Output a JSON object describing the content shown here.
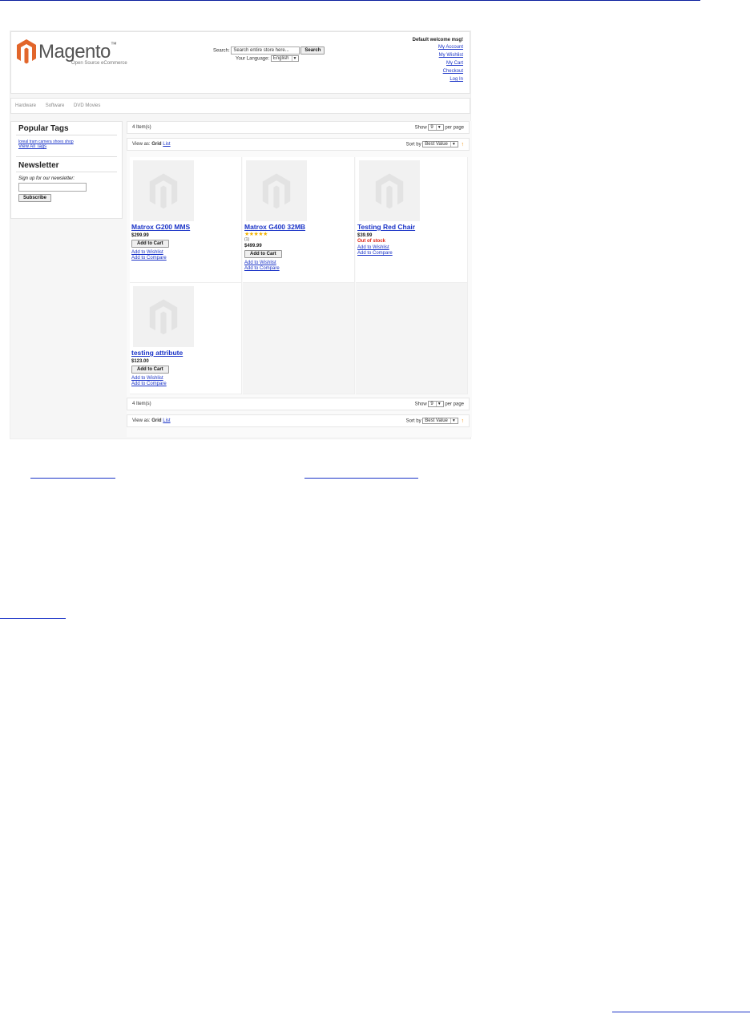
{
  "logo": {
    "word": "Magento",
    "tm": "™",
    "subtitle": "Open Source eCommerce"
  },
  "header": {
    "search_label": "Search:",
    "search_placeholder": "Search entire store here...",
    "search_button": "Search",
    "language_label": "Your Language:",
    "language_value": "English",
    "welcome": "Default welcome msg!",
    "links": [
      "My Account",
      "My Wishlist",
      "My Cart",
      "Checkout",
      "Log In"
    ]
  },
  "nav": {
    "items": [
      "Hardware",
      "Software",
      "DVD Movies"
    ]
  },
  "sidebar": {
    "tags_title": "Popular Tags",
    "tags_text": "loreal  tram  camera  shoes  shop",
    "view_all": "View All Tags",
    "newsletter_title": "Newsletter",
    "newsletter_label": "Sign up for our newsletter:",
    "subscribe": "Subscribe"
  },
  "toolbar": {
    "items_count": "4 Item(s)",
    "show_label": "Show",
    "show_value": "9",
    "per_page": "per page",
    "view_as": "View as:",
    "grid": "Grid",
    "list": "List",
    "sort_by": "Sort by",
    "sort_value": "Best Value",
    "rss_icon": "arrow-up-icon"
  },
  "products": [
    {
      "name": "Matrox G200 MMS",
      "price": "$299.99",
      "add_to_cart": "Add to Cart",
      "wishlist": "Add to Wishlist",
      "compare": "Add to Compare"
    },
    {
      "name": "Matrox G400 32MB",
      "stars": "★★★★★",
      "reviews": "(1)",
      "price": "$499.99",
      "add_to_cart": "Add to Cart",
      "wishlist": "Add to Wishlist",
      "compare": "Add to Compare"
    },
    {
      "name": "Testing Red Chair",
      "price": "$39.99",
      "status": "Out of stock",
      "wishlist": "Add to Wishlist",
      "compare": "Add to Compare"
    },
    {
      "name": "testing attribute",
      "price": "$123.00",
      "add_to_cart": "Add to Cart",
      "wishlist": "Add to Wishlist",
      "compare": "Add to Compare"
    }
  ],
  "colors": {
    "link": "#1a33c7",
    "logo": "#e2662b",
    "out_of_stock": "#dd2211",
    "stars": "#f2b100"
  }
}
